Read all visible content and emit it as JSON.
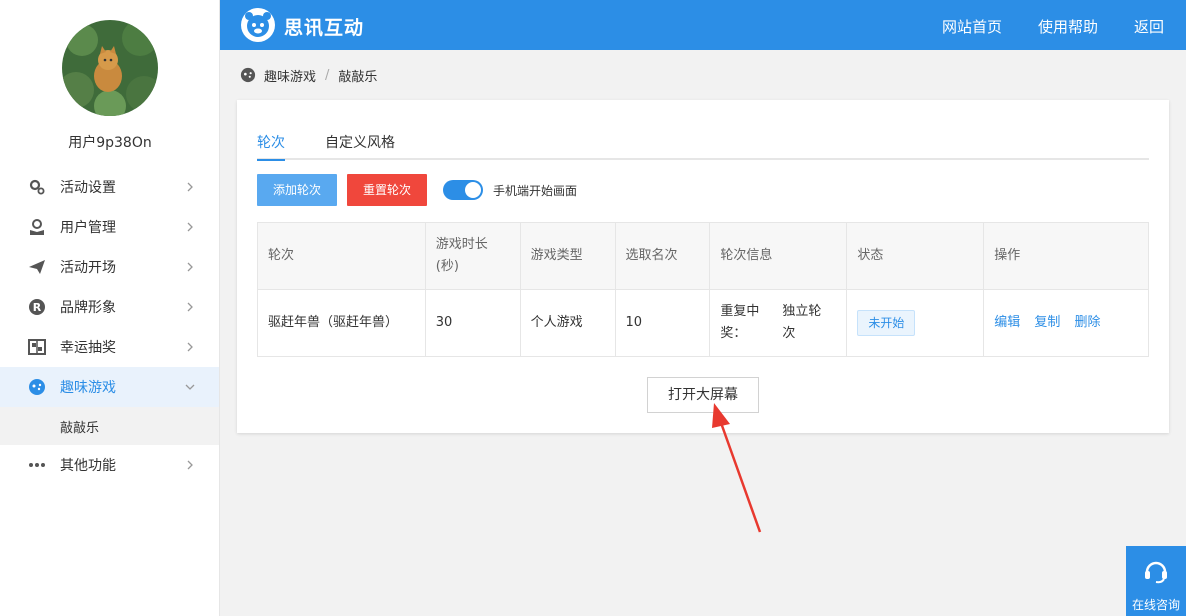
{
  "header": {
    "brand": "思讯互动",
    "nav": [
      "网站首页",
      "使用帮助",
      "返回"
    ]
  },
  "sidebar": {
    "username": "用户9p38On",
    "items": [
      {
        "label": "活动设置",
        "icon": "gear-icon"
      },
      {
        "label": "用户管理",
        "icon": "user-icon"
      },
      {
        "label": "活动开场",
        "icon": "paper-plane-icon"
      },
      {
        "label": "品牌形象",
        "icon": "registered-icon"
      },
      {
        "label": "幸运抽奖",
        "icon": "lottery-icon"
      },
      {
        "label": "趣味游戏",
        "icon": "gamepad-icon",
        "active": true
      },
      {
        "label": "其他功能",
        "icon": "more-dots-icon"
      }
    ],
    "submenu": {
      "label": "敲敲乐"
    }
  },
  "breadcrumb": {
    "parent": "趣味游戏",
    "separator": "/",
    "current": "敲敲乐"
  },
  "tabs": [
    "轮次",
    "自定义风格"
  ],
  "toolbar": {
    "add_label": "添加轮次",
    "reset_label": "重置轮次",
    "switch_label": "手机端开始画面",
    "switch_on": true
  },
  "table": {
    "headers": [
      "轮次",
      "游戏时长(秒)",
      "游戏类型",
      "选取名次",
      "轮次信息",
      "状态",
      "操作"
    ],
    "rows": [
      {
        "round": "驱赶年兽（驱赶年兽）",
        "duration": "30",
        "type": "个人游戏",
        "rank": "10",
        "info": [
          "重复中奖：",
          "独立轮次"
        ],
        "status": "未开始",
        "actions": [
          "编辑",
          "复制",
          "删除"
        ]
      }
    ]
  },
  "open_screen_label": "打开大屏幕",
  "consult_label": "在线咨询",
  "colors": {
    "primary": "#2c8ee6",
    "danger": "#f0473c",
    "annotation": "#e8392f"
  }
}
